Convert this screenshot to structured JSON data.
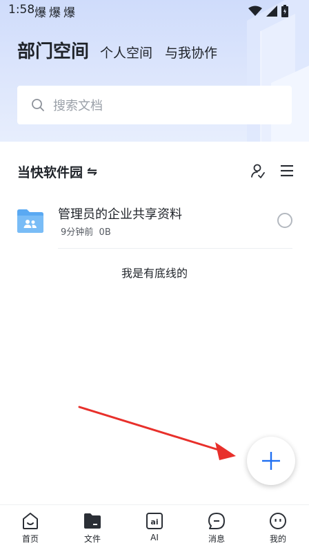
{
  "status_bar": {
    "time": "1:58",
    "notifications": [
      "爆",
      "爆",
      "爆"
    ]
  },
  "header": {
    "tabs": [
      {
        "label": "部门空间",
        "active": true
      },
      {
        "label": "个人空间",
        "active": false
      },
      {
        "label": "与我协作",
        "active": false
      }
    ]
  },
  "search": {
    "placeholder": "搜索文档"
  },
  "space": {
    "name": "当快软件园",
    "swap_symbol": "⇋"
  },
  "files": [
    {
      "name": "管理员的企业共享资料",
      "time": "9分钟前",
      "size": "0B",
      "icon": "shared-folder-icon"
    }
  ],
  "footer_text": "我是有底线的",
  "nav": {
    "items": [
      {
        "label": "首页",
        "icon": "home-icon"
      },
      {
        "label": "文件",
        "icon": "file-icon",
        "active": true
      },
      {
        "label": "AI",
        "icon": "ai-icon"
      },
      {
        "label": "消息",
        "icon": "message-icon"
      },
      {
        "label": "我的",
        "icon": "profile-icon"
      }
    ]
  },
  "colors": {
    "accent": "#1f6ff2",
    "folder": "#5aa9f2",
    "annotation_arrow": "#e8302b"
  }
}
